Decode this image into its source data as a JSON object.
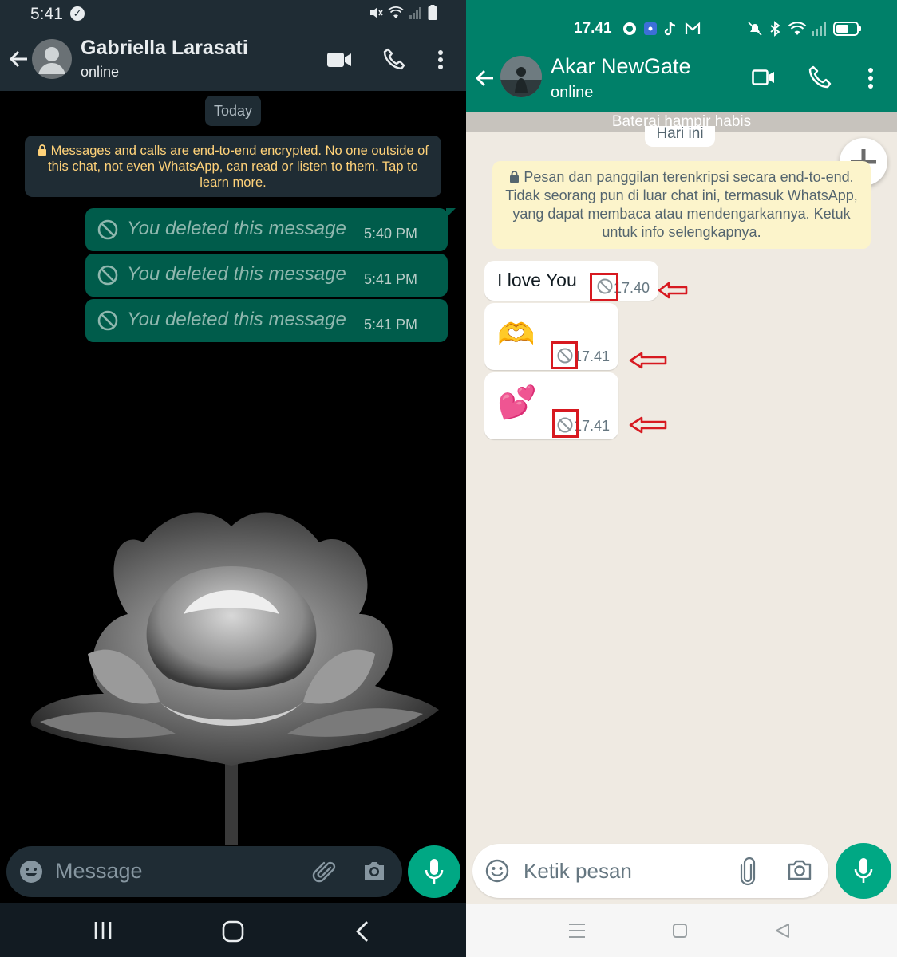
{
  "left": {
    "status_time": "5:41",
    "contact_name": "Gabriella Larasati",
    "contact_status": "online",
    "day_label": "Today",
    "encryption_notice": "Messages and calls are end-to-end encrypted. No one outside of this chat, not even WhatsApp, can read or listen to them. Tap to learn more.",
    "messages": [
      {
        "text": "You deleted this message",
        "time": "5:40 PM"
      },
      {
        "text": "You deleted this message",
        "time": "5:41 PM"
      },
      {
        "text": "You deleted this message",
        "time": "5:41 PM"
      }
    ],
    "composer_placeholder": "Message",
    "colors": {
      "header": "#1f2c34",
      "bubble_out": "#005c4b",
      "accent": "#00a884",
      "notice_text": "#ffd279"
    }
  },
  "right": {
    "status_time": "17.41",
    "contact_name": "Akar NewGate",
    "contact_status": "online",
    "battery_banner": "Baterai hampir habis",
    "day_label": "Hari ini",
    "encryption_notice": "Pesan dan panggilan terenkripsi secara end-to-end. Tidak seorang pun di luar chat ini, termasuk WhatsApp, yang dapat membaca atau mendengarkannya. Ketuk untuk info selengkapnya.",
    "messages": [
      {
        "text": "I love You",
        "time": "17.40"
      },
      {
        "text": "🫶",
        "time": "17.41"
      },
      {
        "text": "💕",
        "time": "17.41"
      }
    ],
    "composer_placeholder": "Ketik pesan",
    "colors": {
      "header": "#008069",
      "wallpaper": "#efeae2",
      "accent": "#00a884",
      "highlight": "#d71920"
    }
  }
}
